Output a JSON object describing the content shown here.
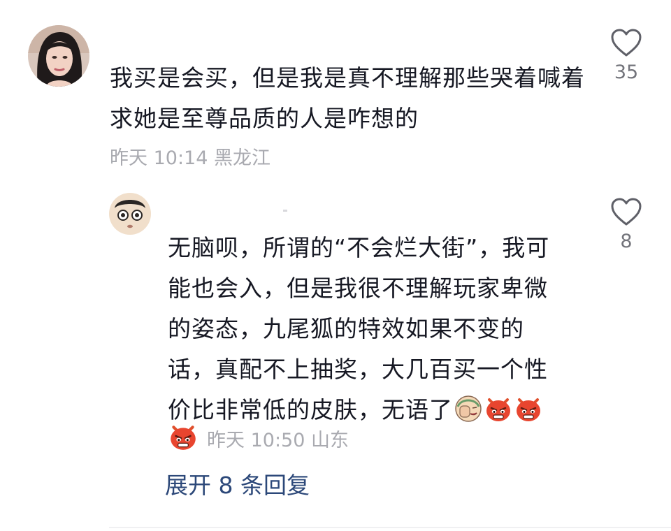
{
  "comment": {
    "text": "我买是会买，但是我是真不理解那些哭着喊着求她是至尊品质的人是咋想的",
    "time": "昨天 10:14",
    "location": "黑龙江",
    "likes": "35",
    "avatar_icon": "woman-portrait-avatar",
    "reply": {
      "text": "无脑呗，所谓的“不会烂大街”，我可能也会入，但是我很不理解玩家卑微的姿态，九尾狐的特效如果不变的话，真配不上抽奖，大几百买一个性价比非常低的皮肤，无语了",
      "emojis": [
        "facepalm-emoji",
        "angry-red-emoji",
        "angry-red-emoji"
      ],
      "meta_emoji": "angry-red-emoji",
      "time": "昨天 10:50",
      "location": "山东",
      "likes": "8",
      "avatar_icon": "cartoon-face-avatar"
    }
  },
  "expand_replies": {
    "label": "展开 8 条回复"
  },
  "colors": {
    "text": "#161823",
    "meta": "#a9aab0",
    "link": "#2c4879",
    "like_count": "#73747b"
  }
}
